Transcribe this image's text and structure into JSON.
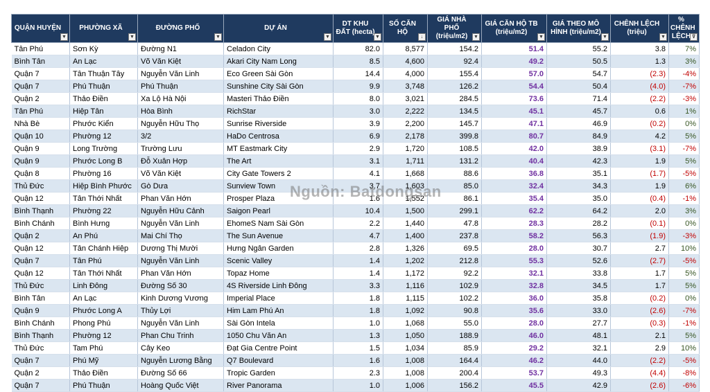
{
  "headers": [
    "QUẬN HUYỆN",
    "PHƯỜNG XÃ",
    "ĐƯỜNG PHỐ",
    "DỰ ÁN",
    "DT KHU ĐẤT (hecta)",
    "SỐ CĂN HỘ",
    "GIÁ NHÀ PHỐ (triệu/m2)",
    "GIÁ CĂN HỘ TB (triệu/m2)",
    "GIÁ THEO MÔ HÌNH (triệu/m2)",
    "CHÊNH LỆCH (triệu)",
    "% CHÊNH LỆCH"
  ],
  "filter_icons": [
    "dropdown-arrow",
    "dropdown-arrow",
    "dropdown-arrow",
    "dropdown-arrow",
    "dropdown-arrow",
    "sort-descending",
    "dropdown-arrow",
    "dropdown-arrow",
    "dropdown-arrow",
    "dropdown-arrow",
    "filter-applied"
  ],
  "watermark": "Nguồn: Batdongsan",
  "colors": {
    "header_bg": "#1f3a5f",
    "row_alt": "#dbe6f1",
    "avg_price": "#7030a0",
    "negative": "#c00000",
    "positive_pct": "#375623"
  },
  "rows": [
    [
      "Tân Phú",
      "Sơn Kỳ",
      "Đường N1",
      "Celadon City",
      "82.0",
      "8,577",
      "154.2",
      "51.4",
      "55.2",
      "3.8",
      "7%"
    ],
    [
      "Bình Tân",
      "An Lạc",
      "Võ Văn Kiệt",
      "Akari City Nam Long",
      "8.5",
      "4,600",
      "92.4",
      "49.2",
      "50.5",
      "1.3",
      "3%"
    ],
    [
      "Quận 7",
      "Tân Thuận Tây",
      "Nguyễn Văn Linh",
      "Eco Green Sài Gòn",
      "14.4",
      "4,000",
      "155.4",
      "57.0",
      "54.7",
      "(2.3)",
      "-4%"
    ],
    [
      "Quận 7",
      "Phú Thuận",
      "Phú Thuận",
      "Sunshine City Sài Gòn",
      "9.9",
      "3,748",
      "126.2",
      "54.4",
      "50.4",
      "(4.0)",
      "-7%"
    ],
    [
      "Quận 2",
      "Thảo Điền",
      "Xa Lộ Hà Nội",
      "Masteri Thảo Điền",
      "8.0",
      "3,021",
      "284.5",
      "73.6",
      "71.4",
      "(2.2)",
      "-3%"
    ],
    [
      "Tân Phú",
      "Hiệp Tân",
      "Hòa Bình",
      "RichStar",
      "3.0",
      "2,222",
      "134.5",
      "45.1",
      "45.7",
      "0.6",
      "1%"
    ],
    [
      "Nhà Bè",
      "Phước Kiển",
      "Nguyễn Hữu Thọ",
      "Sunrise Riverside",
      "3.9",
      "2,200",
      "145.7",
      "47.1",
      "46.9",
      "(0.2)",
      "0%"
    ],
    [
      "Quận 10",
      "Phường 12",
      "3/2",
      "HaDo Centrosa",
      "6.9",
      "2,178",
      "399.8",
      "80.7",
      "84.9",
      "4.2",
      "5%"
    ],
    [
      "Quận 9",
      "Long Trường",
      "Trường Lưu",
      "MT Eastmark City",
      "2.9",
      "1,720",
      "108.5",
      "42.0",
      "38.9",
      "(3.1)",
      "-7%"
    ],
    [
      "Quận 9",
      "Phước Long B",
      "Đỗ Xuân Hợp",
      "The Art",
      "3.1",
      "1,711",
      "131.2",
      "40.4",
      "42.3",
      "1.9",
      "5%"
    ],
    [
      "Quận 8",
      "Phường 16",
      "Võ Văn Kiệt",
      "City Gate Towers 2",
      "4.1",
      "1,668",
      "88.6",
      "36.8",
      "35.1",
      "(1.7)",
      "-5%"
    ],
    [
      "Thủ Đức",
      "Hiệp Bình Phước",
      "Gò Dưa",
      "Sunview Town",
      "3.7",
      "1,603",
      "85.0",
      "32.4",
      "34.3",
      "1.9",
      "6%"
    ],
    [
      "Quận 12",
      "Tân Thới Nhất",
      "Phan Văn Hớn",
      "Prosper Plaza",
      "1.6",
      "1,552",
      "86.1",
      "35.4",
      "35.0",
      "(0.4)",
      "-1%"
    ],
    [
      "Bình Thạnh",
      "Phường 22",
      "Nguyễn Hữu Cảnh",
      "Saigon Pearl",
      "10.4",
      "1,500",
      "299.1",
      "62.2",
      "64.2",
      "2.0",
      "3%"
    ],
    [
      "Bình Chánh",
      "Bình Hưng",
      "Nguyễn Văn Linh",
      "EhomeS Nam Sài Gòn",
      "2.2",
      "1,440",
      "47.8",
      "28.3",
      "28.2",
      "(0.1)",
      "0%"
    ],
    [
      "Quận 2",
      "An Phú",
      "Mai Chí Thọ",
      "The Sun Avenue",
      "4.7",
      "1,400",
      "237.8",
      "58.2",
      "56.3",
      "(1.9)",
      "-3%"
    ],
    [
      "Quận 12",
      "Tân Chánh Hiệp",
      "Dương Thị Mười",
      "Hưng Ngân Garden",
      "2.8",
      "1,326",
      "69.5",
      "28.0",
      "30.7",
      "2.7",
      "10%"
    ],
    [
      "Quận 7",
      "Tân Phú",
      "Nguyễn Văn Linh",
      "Scenic Valley",
      "1.4",
      "1,202",
      "212.8",
      "55.3",
      "52.6",
      "(2.7)",
      "-5%"
    ],
    [
      "Quận 12",
      "Tân Thới Nhất",
      "Phan Văn Hớn",
      "Topaz Home",
      "1.4",
      "1,172",
      "92.2",
      "32.1",
      "33.8",
      "1.7",
      "5%"
    ],
    [
      "Thủ Đức",
      "Linh Đông",
      "Đường Số 30",
      "4S Riverside Linh Đông",
      "3.3",
      "1,116",
      "102.9",
      "32.8",
      "34.5",
      "1.7",
      "5%"
    ],
    [
      "Bình Tân",
      "An Lạc",
      "Kinh Dương Vương",
      "Imperial Place",
      "1.8",
      "1,115",
      "102.2",
      "36.0",
      "35.8",
      "(0.2)",
      "0%"
    ],
    [
      "Quận 9",
      "Phước Long A",
      "Thủy Lợi",
      "Him Lam Phú An",
      "1.8",
      "1,092",
      "90.8",
      "35.6",
      "33.0",
      "(2.6)",
      "-7%"
    ],
    [
      "Bình Chánh",
      "Phong Phú",
      "Nguyễn Văn Linh",
      "Sài Gòn Intela",
      "1.0",
      "1,068",
      "55.0",
      "28.0",
      "27.7",
      "(0.3)",
      "-1%"
    ],
    [
      "Bình Thạnh",
      "Phường 12",
      "Phan Chu Trinh",
      "1050 Chu Văn An",
      "1.3",
      "1,050",
      "188.9",
      "46.0",
      "48.1",
      "2.1",
      "5%"
    ],
    [
      "Thủ Đức",
      "Tam Phú",
      "Cây Keo",
      "Đạt Gia Centre Point",
      "1.5",
      "1,034",
      "85.9",
      "29.2",
      "32.1",
      "2.9",
      "10%"
    ],
    [
      "Quận 7",
      "Phú Mỹ",
      "Nguyễn Lương Bằng",
      "Q7 Boulevard",
      "1.6",
      "1,008",
      "164.4",
      "46.2",
      "44.0",
      "(2.2)",
      "-5%"
    ],
    [
      "Quận 2",
      "Thảo Điền",
      "Đường Số 66",
      "Tropic Garden",
      "2.3",
      "1,008",
      "200.4",
      "53.7",
      "49.3",
      "(4.4)",
      "-8%"
    ],
    [
      "Quận 7",
      "Phú Thuận",
      "Hoàng Quốc Việt",
      "River Panorama",
      "1.0",
      "1,006",
      "156.2",
      "45.5",
      "42.9",
      "(2.6)",
      "-6%"
    ]
  ]
}
